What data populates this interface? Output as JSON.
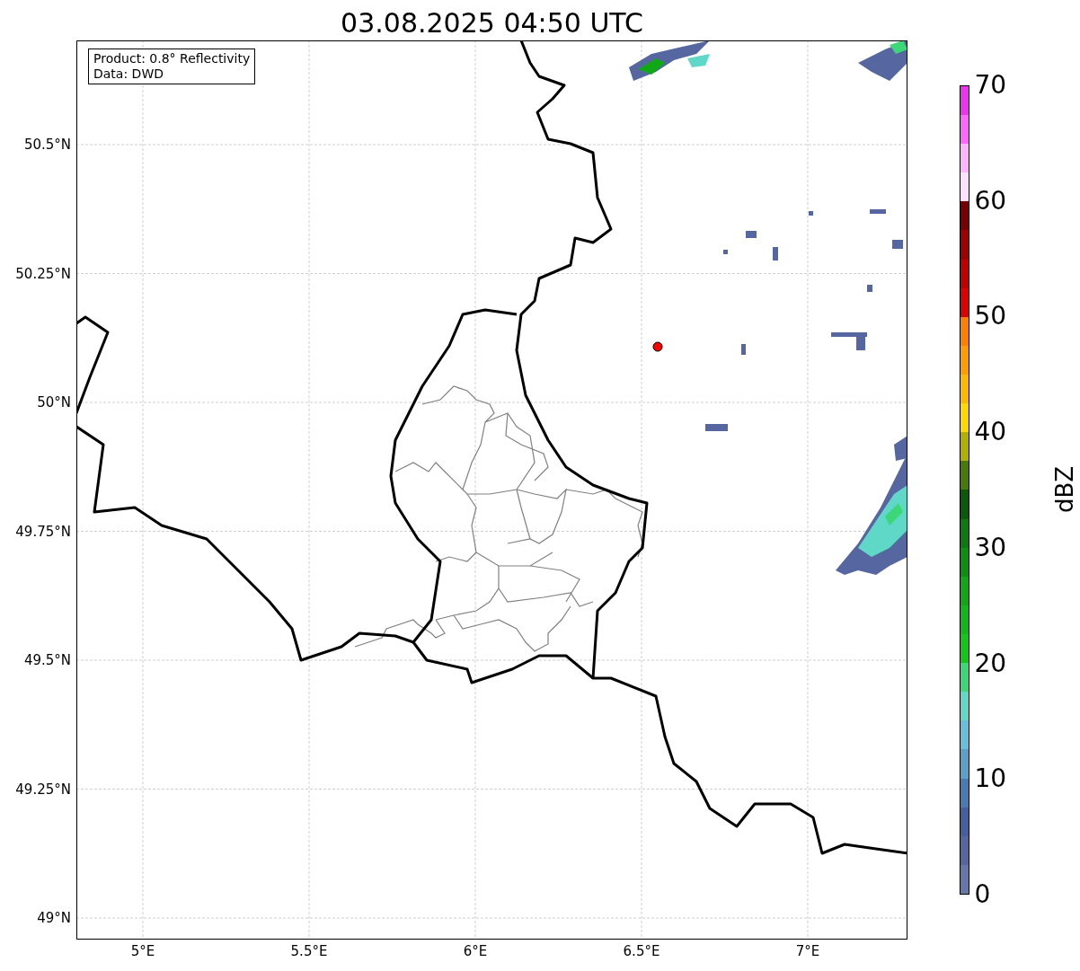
{
  "title": "03.08.2025 04:50 UTC",
  "info_box": [
    "Product: 0.8° Reflectivity",
    "Data: DWD"
  ],
  "map": {
    "xticks": [
      "5°E",
      "5.5°E",
      "6°E",
      "6.5°E",
      "7°E"
    ],
    "yticks": [
      "50.5°N",
      "50.25°N",
      "50°N",
      "49.75°N",
      "49.5°N",
      "49.25°N",
      "49°N"
    ]
  },
  "colorbar": {
    "label": "dBZ",
    "ticks": [
      "70",
      "60",
      "50",
      "40",
      "30",
      "20",
      "10",
      "0"
    ],
    "bins": [
      {
        "color": "#6677aa"
      },
      {
        "color": "#5566a0"
      },
      {
        "color": "#4460a0"
      },
      {
        "color": "#4a7ab4"
      },
      {
        "color": "#5aa0c8"
      },
      {
        "color": "#66c0dc"
      },
      {
        "color": "#60d8c8"
      },
      {
        "color": "#3cd878"
      },
      {
        "color": "#10c818"
      },
      {
        "color": "#10b818"
      },
      {
        "color": "#10a814"
      },
      {
        "color": "#0c9010"
      },
      {
        "color": "#0c7c10"
      },
      {
        "color": "#0a5a0a"
      },
      {
        "color": "#487a0a"
      },
      {
        "color": "#b0b000"
      },
      {
        "color": "#ffd800"
      },
      {
        "color": "#ffb800"
      },
      {
        "color": "#ff9c00"
      },
      {
        "color": "#ff8000"
      },
      {
        "color": "#e00000"
      },
      {
        "color": "#c00000"
      },
      {
        "color": "#a00000"
      },
      {
        "color": "#780000"
      },
      {
        "color": "#ffe0ff"
      },
      {
        "color": "#ffb4ff"
      },
      {
        "color": "#ff66ff"
      },
      {
        "color": "#ee33ee"
      }
    ]
  }
}
